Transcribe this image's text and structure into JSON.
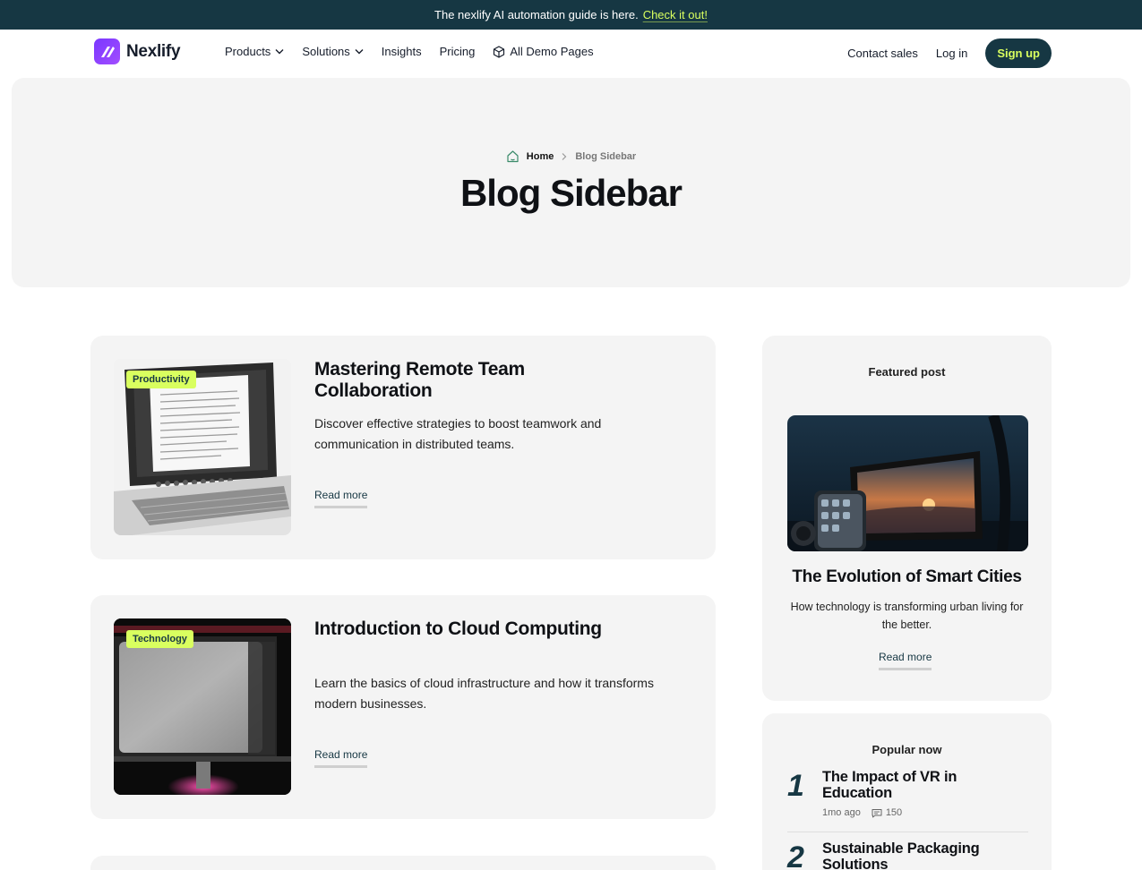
{
  "announcement": {
    "text": "The nexlify AI automation guide is here.",
    "link": "Check it out!"
  },
  "nav": {
    "brand": "Nexlify",
    "menu": [
      {
        "label": "Products",
        "has_dropdown": true
      },
      {
        "label": "Solutions",
        "has_dropdown": true
      },
      {
        "label": "Insights",
        "has_dropdown": false
      },
      {
        "label": "Pricing",
        "has_dropdown": false
      },
      {
        "label": "All Demo Pages",
        "icon": "cube-icon"
      }
    ],
    "contact_sales": "Contact sales",
    "login": "Log in",
    "signup": "Sign up"
  },
  "hero": {
    "breadcrumb_home": "Home",
    "breadcrumb_current": "Blog Sidebar",
    "title": "Blog Sidebar"
  },
  "posts": [
    {
      "tag": "Productivity",
      "title": "Mastering Remote Team Collaboration",
      "description": "Discover effective strategies to boost teamwork and communication in distributed teams.",
      "read_more": "Read more"
    },
    {
      "tag": "Technology",
      "title": "Introduction to Cloud Computing",
      "description": "Learn the basics of cloud infrastructure and how it transforms modern businesses.",
      "read_more": "Read more"
    }
  ],
  "sidebar": {
    "featured": {
      "heading": "Featured post",
      "title": "The Evolution of Smart Cities",
      "description": "How technology is transforming urban living for the better.",
      "read_more": "Read more"
    },
    "popular": {
      "heading": "Popular now",
      "items": [
        {
          "number": "1",
          "title": "The Impact of VR in Education",
          "time": "1mo ago",
          "comments": "150"
        },
        {
          "number": "2",
          "title": "Sustainable Packaging Solutions"
        }
      ]
    }
  },
  "colors": {
    "primary": "#163743",
    "accent": "#d9ff5f",
    "card_bg": "#f4f4f4",
    "brand_purple": "#8a3dff"
  }
}
